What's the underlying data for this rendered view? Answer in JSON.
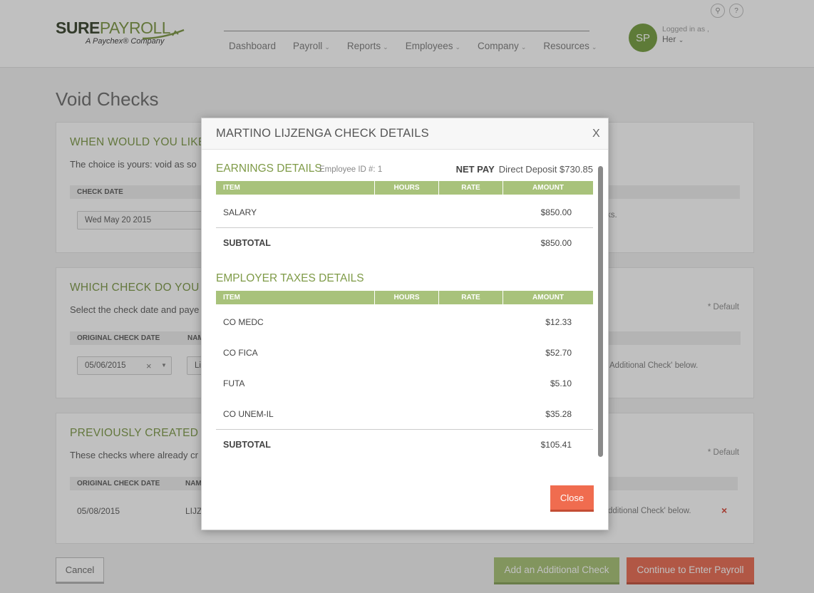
{
  "header": {
    "brand_sure": "SURE",
    "brand_payroll": "PAYROLL",
    "brand_tagline": "A Paychex® Company",
    "nav": [
      "Dashboard",
      "Payroll",
      "Reports",
      "Employees",
      "Company",
      "Resources"
    ],
    "avatar_initials": "SP",
    "logged_in_label": "Logged in as ,",
    "user_name": "Her"
  },
  "page": {
    "title": "Void Checks",
    "panel1": {
      "heading": "WHEN WOULD YOU LIKE T",
      "desc": "The choice is yours: void as so",
      "col_check_date": "CHECK DATE",
      "check_date_value": "Wed May 20 2015",
      "side_text": "ks."
    },
    "panel2": {
      "heading": "WHICH CHECK DO YOU NE",
      "desc": "Select the check date and paye",
      "default_note": "* Default",
      "col_original_date": "ORIGINAL CHECK DATE",
      "col_name": "NAM",
      "date_value": "05/06/2015",
      "name_value": "Li",
      "side_text": "Additional Check' below."
    },
    "panel3": {
      "heading": "PREVIOUSLY CREATED CHE",
      "desc": "These checks where already cr",
      "default_note": "* Default",
      "col_original_date": "ORIGINAL CHECK DATE",
      "col_name": "NAM",
      "row_date": "05/08/2015",
      "row_name": "LIJZI",
      "side_text": "dditional Check' below.",
      "delete_glyph": "×"
    },
    "buttons": {
      "cancel": "Cancel",
      "add_check": "Add an Additional Check",
      "continue": "Continue to Enter Payroll"
    }
  },
  "modal": {
    "title": "MARTINO LIJZENGA CHECK DETAILS",
    "close_x": "X",
    "earnings": {
      "heading": "EARNINGS DETAILS",
      "employee_id": "Employee ID #: 1",
      "net_pay_label": "NET PAY",
      "net_pay_value": "Direct Deposit $730.85",
      "columns": [
        "ITEM",
        "HOURS",
        "RATE",
        "AMOUNT"
      ],
      "rows": [
        {
          "item": "SALARY",
          "amount": "$850.00"
        }
      ],
      "subtotal_label": "SUBTOTAL",
      "subtotal_value": "$850.00"
    },
    "taxes": {
      "heading": "EMPLOYER TAXES DETAILS",
      "columns": [
        "ITEM",
        "HOURS",
        "RATE",
        "AMOUNT"
      ],
      "rows": [
        {
          "item": "CO MEDC",
          "amount": "$12.33"
        },
        {
          "item": "CO FICA",
          "amount": "$52.70"
        },
        {
          "item": "FUTA",
          "amount": "$5.10"
        },
        {
          "item": "CO UNEM-IL",
          "amount": "$35.28"
        }
      ],
      "subtotal_label": "SUBTOTAL",
      "subtotal_value": "$105.41"
    },
    "close_button": "Close"
  },
  "colors": {
    "brand_green": "#77943f",
    "table_header_green": "#a8c27b",
    "accent_orange": "#f06c4f",
    "avatar_green": "#6f9a37"
  }
}
